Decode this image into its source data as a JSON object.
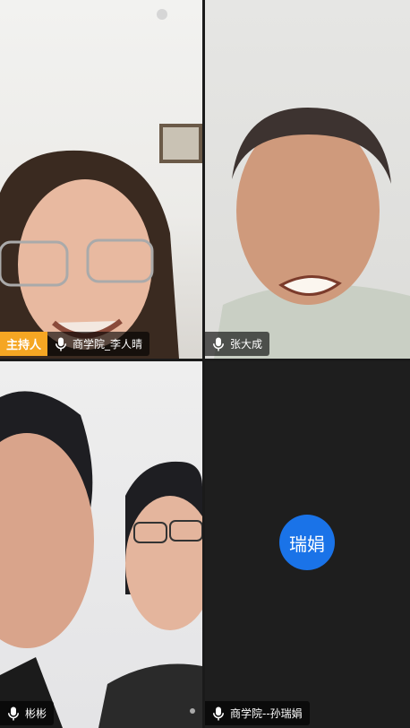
{
  "participants": [
    {
      "name": "商学院_李人晴",
      "role_badge": "主持人"
    },
    {
      "name": "张大成"
    },
    {
      "name": "彬彬"
    },
    {
      "name": "商学院--孙瑞娟",
      "avatar_text": "瑞娟"
    }
  ],
  "colors": {
    "host_badge": "#f5a623",
    "avatar": "#1a73e8"
  }
}
